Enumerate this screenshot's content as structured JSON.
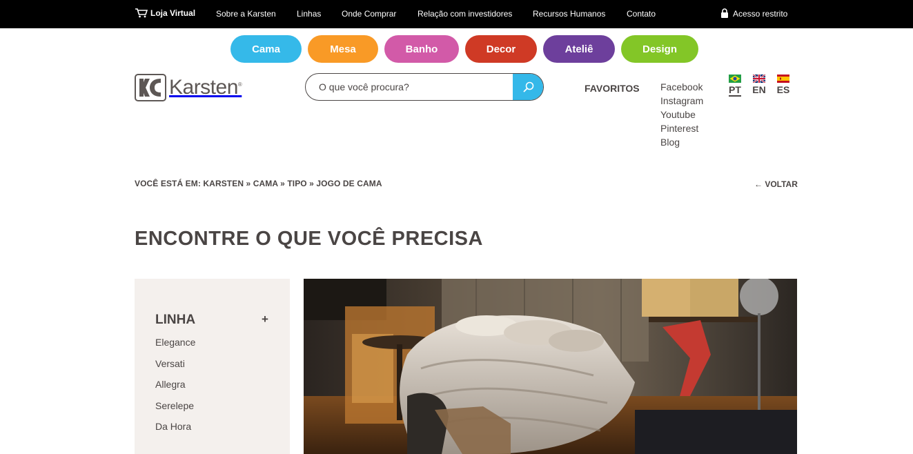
{
  "topbar": {
    "store_label": "Loja Virtual",
    "links": [
      "Sobre a Karsten",
      "Linhas",
      "Onde Comprar",
      "Relação com investidores",
      "Recursos Humanos",
      "Contato"
    ],
    "restricted_label": "Acesso restrito"
  },
  "categories": [
    {
      "label": "Cama",
      "color": "#35b9e9"
    },
    {
      "label": "Mesa",
      "color": "#f99a26"
    },
    {
      "label": "Banho",
      "color": "#d25aa8"
    },
    {
      "label": "Decor",
      "color": "#cf3a25"
    },
    {
      "label": "Ateliê",
      "color": "#6d3f9c"
    },
    {
      "label": "Design",
      "color": "#83c627"
    }
  ],
  "logo": {
    "text": "Karsten",
    "reg": "®"
  },
  "search": {
    "placeholder": "O que você procura?",
    "button_color": "#34b8e9"
  },
  "favorites_label": "FAVORITOS",
  "social": [
    "Facebook",
    "Instagram",
    "Youtube",
    "Pinterest",
    "Blog"
  ],
  "languages": [
    {
      "code": "PT",
      "flag": "brazil-flag-icon",
      "active": true
    },
    {
      "code": "EN",
      "flag": "uk-flag-icon",
      "active": false
    },
    {
      "code": "ES",
      "flag": "spain-flag-icon",
      "active": false
    }
  ],
  "breadcrumb": "VOCÊ ESTÁ EM: KARSTEN » CAMA » TIPO » JOGO DE CAMA",
  "back_label": "← VOLTAR",
  "page_title": "ENCONTRE O QUE VOCÊ PRECISA",
  "filter": {
    "heading": "LINHA",
    "toggle": "+",
    "items": [
      "Elegance",
      "Versati",
      "Allegra",
      "Serelepe",
      "Da Hora"
    ]
  },
  "hero": {
    "image": "bedroom-photo"
  }
}
